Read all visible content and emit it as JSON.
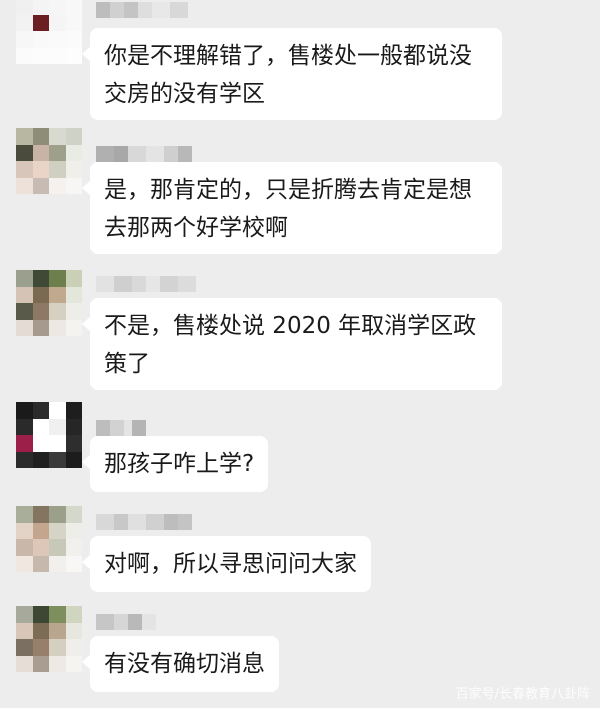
{
  "chat": {
    "messages": [
      {
        "text": "你是不理解错了，售楼处一般都说没\n交房的没有学区"
      },
      {
        "text": "是，那肯定的，只是折腾去肯定是想\n去那两个好学校啊"
      },
      {
        "text": "不是，售楼处说 2020 年取消学区政\n策了"
      },
      {
        "text": "那孩子咋上学?"
      },
      {
        "text": "对啊，所以寻思问问大家"
      },
      {
        "text": "有没有确切消息"
      }
    ]
  },
  "watermark": "百家号/长春教育八卦阵",
  "colors": {
    "background": "#ededed",
    "bubble": "#ffffff",
    "text": "#1a1a1a"
  }
}
